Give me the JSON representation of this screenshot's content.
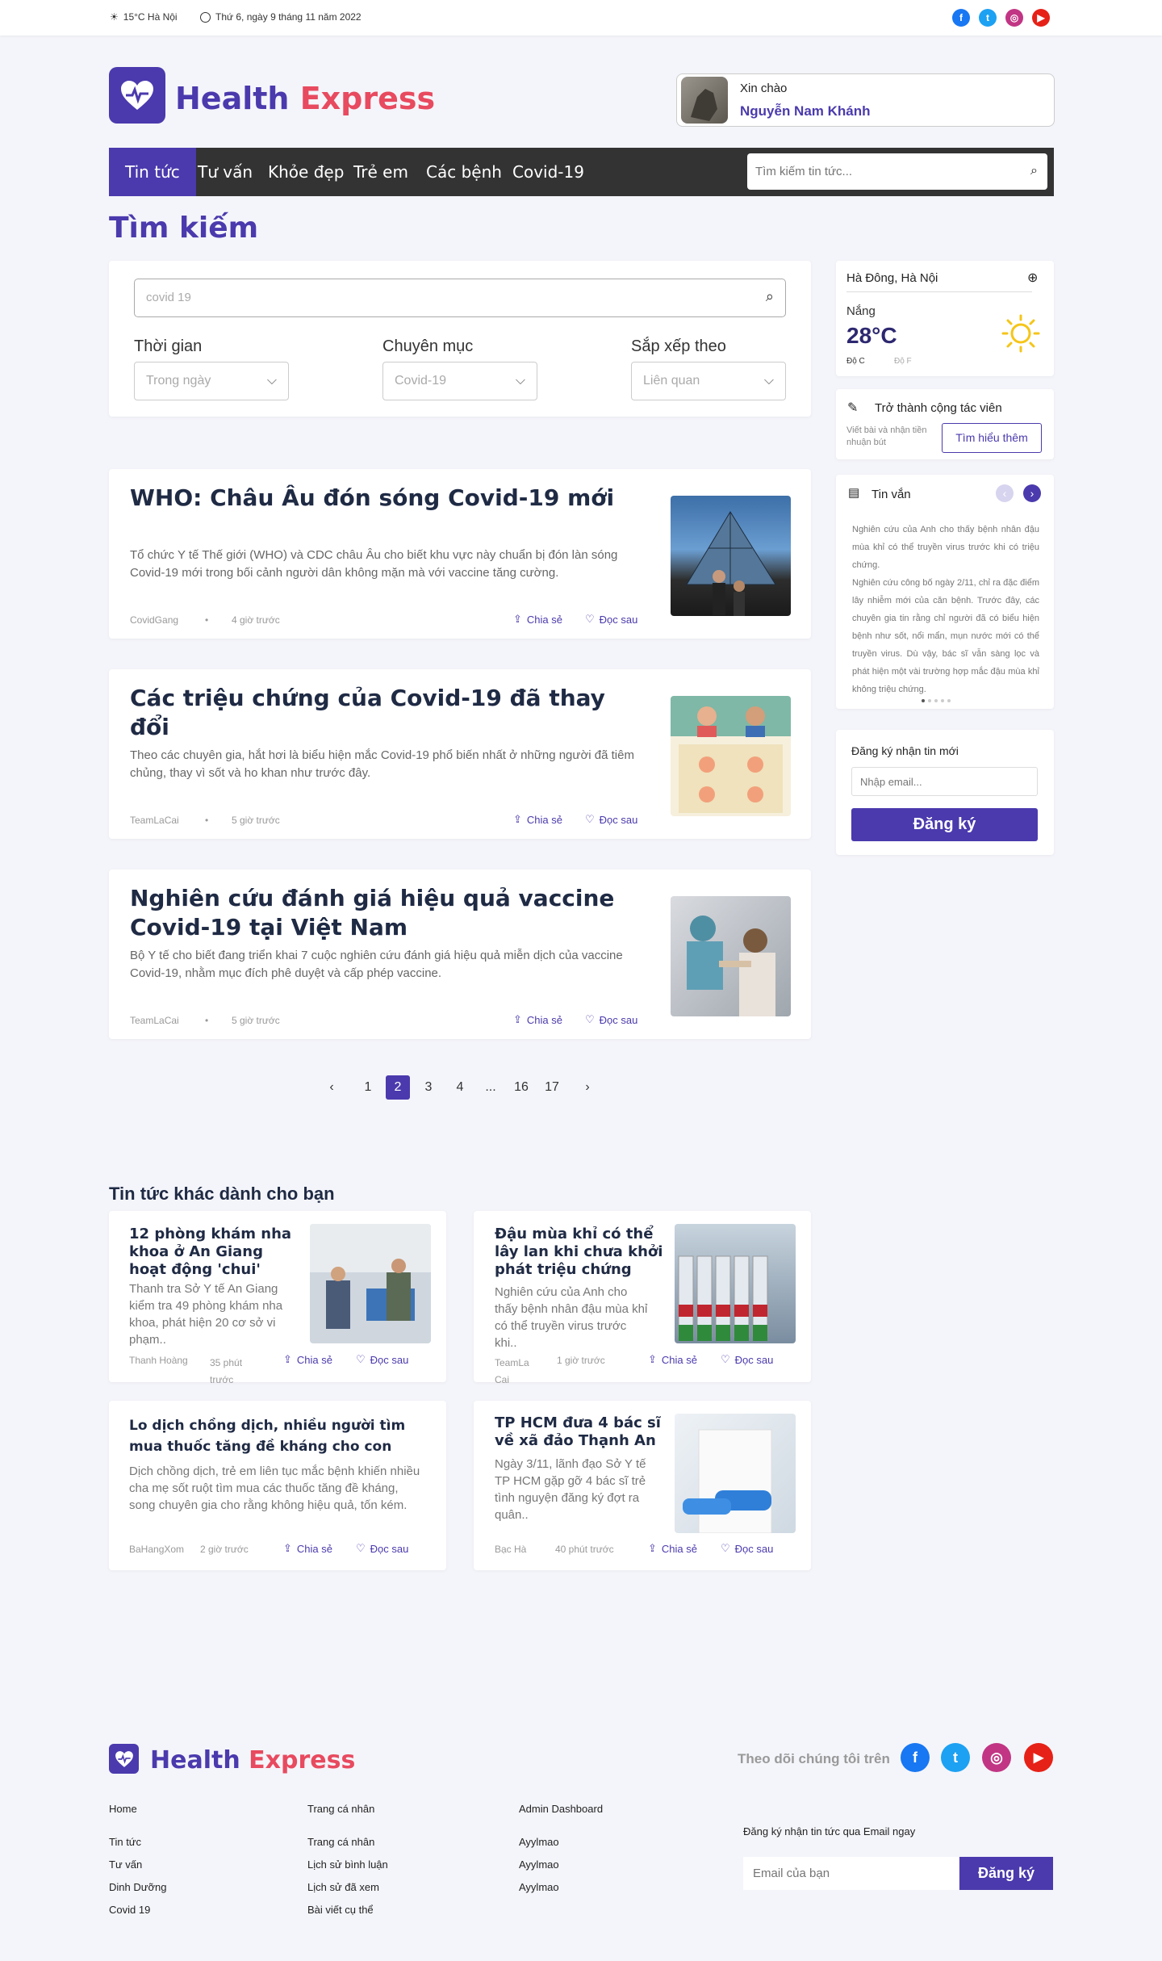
{
  "topbar": {
    "weather": "15°C Hà Nội",
    "date": "Thứ 6, ngày 9 tháng 11 năm 2022"
  },
  "brand": {
    "name1": "Health",
    "name2": "Express",
    "primary": "#4a3aad",
    "accent": "#e84a5f"
  },
  "user": {
    "greeting": "Xin chào",
    "name": "Nguyễn Nam Khánh"
  },
  "nav": {
    "items": [
      "Tin tức",
      "Tư vấn",
      "Khỏe đẹp",
      "Trẻ em",
      "Các bệnh",
      "Covid-19"
    ],
    "search_placeholder": "Tìm kiếm tin tức..."
  },
  "page_title": "Tìm kiếm",
  "search": {
    "value": "covid 19",
    "filters": [
      {
        "label": "Thời gian",
        "value": "Trong ngày"
      },
      {
        "label": "Chuyên mục",
        "value": "Covid-19"
      },
      {
        "label": "Sắp xếp theo",
        "value": "Liên quan"
      }
    ]
  },
  "results": [
    {
      "title": "WHO: Châu Âu đón sóng Covid-19 mới",
      "desc": "Tổ chức Y tế Thế giới (WHO) và CDC châu Âu cho biết khu vực này chuẩn bị đón làn sóng Covid-19 mới trong bối cảnh người dân không mặn mà với vaccine tăng cường.",
      "author": "CovidGang",
      "time": "4 giờ trước"
    },
    {
      "title": "Các triệu chứng của Covid-19 đã thay đổi",
      "desc": "Theo các chuyên gia, hắt hơi là biểu hiện mắc Covid-19 phổ biến nhất ở những người đã tiêm chủng, thay vì sốt và ho khan như trước đây.",
      "author": "TeamLaCai",
      "time": "5 giờ trước"
    },
    {
      "title": "Nghiên cứu đánh giá hiệu quả vaccine Covid-19 tại Việt Nam",
      "desc": "Bộ Y tế cho biết đang triển khai 7 cuộc nghiên cứu đánh giá hiệu quả miễn dịch của vaccine Covid-19, nhằm mục đích phê duyệt và cấp phép vaccine.",
      "author": "TeamLaCai",
      "time": "5 giờ trước"
    }
  ],
  "actions": {
    "share": "Chia sẻ",
    "save": "Đọc sau"
  },
  "pagination": {
    "prev": "‹",
    "pages": [
      "1",
      "2",
      "3",
      "4",
      "...",
      "16",
      "17"
    ],
    "current": "2",
    "next": "›"
  },
  "sidebar": {
    "weather": {
      "location": "Hà Đông, Hà Nội",
      "condition": "Nắng",
      "temp": "28°C",
      "unit_c": "Độ C",
      "unit_f": "Độ F"
    },
    "contrib": {
      "title": "Trở thành cộng tác viên",
      "desc": "Viết bài và nhận tiền nhuận bút",
      "button": "Tìm hiểu thêm"
    },
    "tinvan": {
      "title": "Tin vắn",
      "text": "Nghiên cứu của Anh cho thấy bệnh nhân đậu mùa khỉ có thể truyền virus trước khi có triệu chứng.",
      "text2": "Nghiên cứu công bố ngày 2/11, chỉ ra đặc điểm lây nhiễm mới của căn bệnh. Trước đây, các chuyên gia tin rằng chỉ người đã có biểu hiện bệnh như sốt, nổi mẩn, mụn nước mới có thể truyền virus. Dù vậy, bác sĩ vẫn sàng lọc và phát hiện một vài trường hợp mắc đậu mùa khỉ không triệu chứng."
    },
    "newsletter": {
      "title": "Đăng ký nhận tin mới",
      "placeholder": "Nhập email...",
      "button": "Đăng ký"
    }
  },
  "recommend": {
    "heading": "Tin tức khác dành cho bạn",
    "items": [
      {
        "title": "12 phòng khám nha khoa ở An Giang hoạt động 'chui'",
        "desc": "Thanh tra Sở Y tế An Giang kiểm tra 49 phòng khám nha khoa, phát hiện 20 cơ sở vi phạm..",
        "author": "Thanh Hoàng",
        "time": "35 phút trước"
      },
      {
        "title": "Đậu mùa khỉ có thể lây lan khi chưa khởi phát triệu chứng",
        "desc": "Nghiên cứu của Anh cho thấy bệnh nhân đậu mùa khỉ có thể truyền virus trước khi..",
        "author": "TeamLa Cai",
        "time": "1 giờ trước"
      },
      {
        "title": "Lo dịch chồng dịch, nhiều người tìm mua thuốc tăng đề kháng cho con",
        "desc": "Dịch chồng dịch, trẻ em liên tục mắc bệnh khiến nhiều cha mẹ sốt ruột tìm mua các thuốc tăng đề kháng, song chuyên gia cho rằng không hiệu quả, tốn kém.",
        "author": "BaHangXom",
        "time": "2 giờ trước"
      },
      {
        "title": "TP HCM đưa 4 bác sĩ về xã đảo Thạnh An",
        "desc": "Ngày 3/11, lãnh đạo Sở Y tế TP HCM gặp gỡ 4 bác sĩ trẻ tình nguyện đăng ký đợt ra quân..",
        "author": "Bạc Hà",
        "time": "40 phút trước"
      }
    ]
  },
  "footer": {
    "follow": "Theo dõi chúng tôi trên",
    "col1": [
      "Home",
      "Tin tức",
      "Tư vấn",
      "Dinh Dưỡng",
      "Covid 19"
    ],
    "col2": [
      "Trang cá nhân",
      "Trang cá nhân",
      "Lịch sử bình luận",
      "Lịch sử đã xem",
      "Bài viết cụ thể"
    ],
    "col3": [
      "Admin Dashboard",
      "Ayylmao",
      "Ayylmao",
      "Ayylmao"
    ],
    "newsletter_title": "Đăng ký nhận tin tức qua Email ngay",
    "placeholder": "Email của bạn",
    "button": "Đăng ký"
  }
}
